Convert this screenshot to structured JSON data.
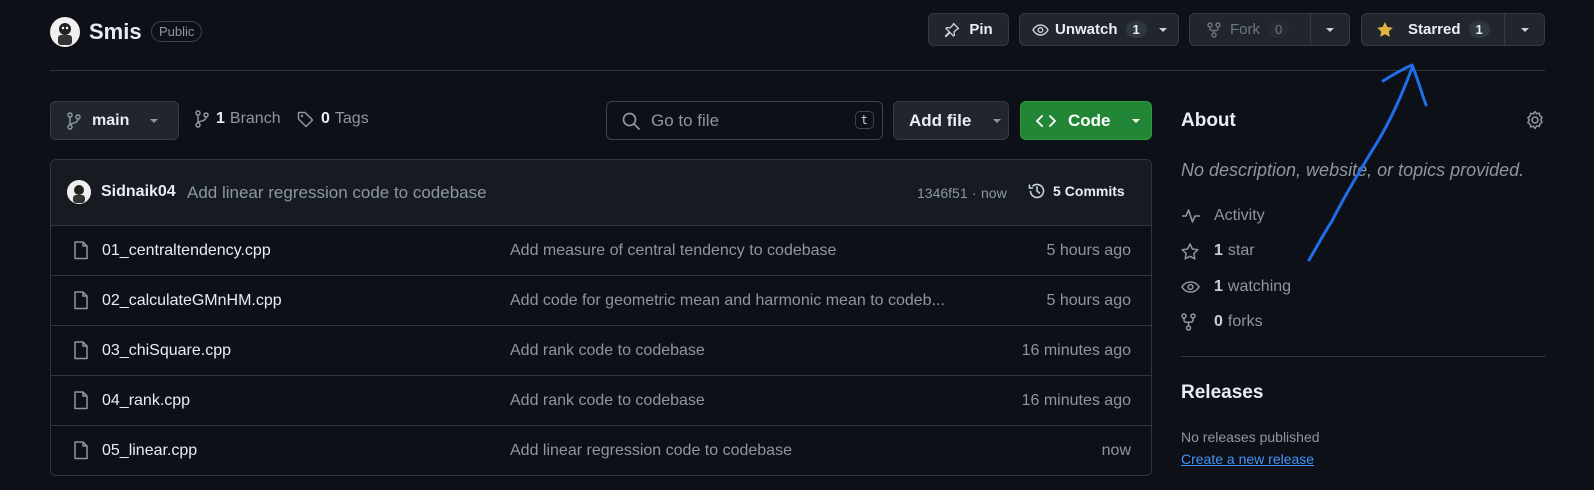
{
  "repo": {
    "name": "Smis",
    "visibility": "Public"
  },
  "actions": {
    "pin": "Pin",
    "unwatch": "Unwatch",
    "unwatch_count": "1",
    "fork": "Fork",
    "fork_count": "0",
    "starred": "Starred",
    "star_count": "1"
  },
  "toolbar": {
    "branch": "main",
    "branches_count": "1",
    "branches_label": "Branch",
    "tags_count": "0",
    "tags_label": "Tags",
    "goto_placeholder": "Go to file",
    "goto_shortcut": "t",
    "add_file": "Add file",
    "code": "Code"
  },
  "commit": {
    "author": "Sidnaik04",
    "message": "Add linear regression code to codebase",
    "hash": "1346f51",
    "sep": "·",
    "when": "now",
    "commits_count": "5",
    "commits_label": "Commits"
  },
  "files": [
    {
      "name": "01_centraltendency.cpp",
      "message": "Add measure of central tendency to codebase",
      "time": "5 hours ago"
    },
    {
      "name": "02_calculateGMnHM.cpp",
      "message": "Add code for geometric mean and harmonic mean to codeb...",
      "time": "5 hours ago"
    },
    {
      "name": "03_chiSquare.cpp",
      "message": "Add rank code to codebase",
      "time": "16 minutes ago"
    },
    {
      "name": "04_rank.cpp",
      "message": "Add rank code to codebase",
      "time": "16 minutes ago"
    },
    {
      "name": "05_linear.cpp",
      "message": "Add linear regression code to codebase",
      "time": "now"
    }
  ],
  "about": {
    "title": "About",
    "description": "No description, website, or topics provided.",
    "activity": "Activity",
    "stars_count": "1",
    "stars_label": "star",
    "watching_count": "1",
    "watching_label": "watching",
    "forks_count": "0",
    "forks_label": "forks"
  },
  "releases": {
    "title": "Releases",
    "none": "No releases published",
    "create": "Create a new release"
  },
  "colors": {
    "background": "#0d1117",
    "code_button": "#238636",
    "annotation": "#1f6feb",
    "link": "#4493f8",
    "star": "#e3b341"
  },
  "icons": [
    "avatar",
    "pin-icon",
    "eye-icon",
    "fork-icon",
    "star-icon",
    "branch-icon",
    "tag-icon",
    "search-icon",
    "code-icon",
    "history-icon",
    "file-icon",
    "gear-icon",
    "pulse-icon"
  ]
}
